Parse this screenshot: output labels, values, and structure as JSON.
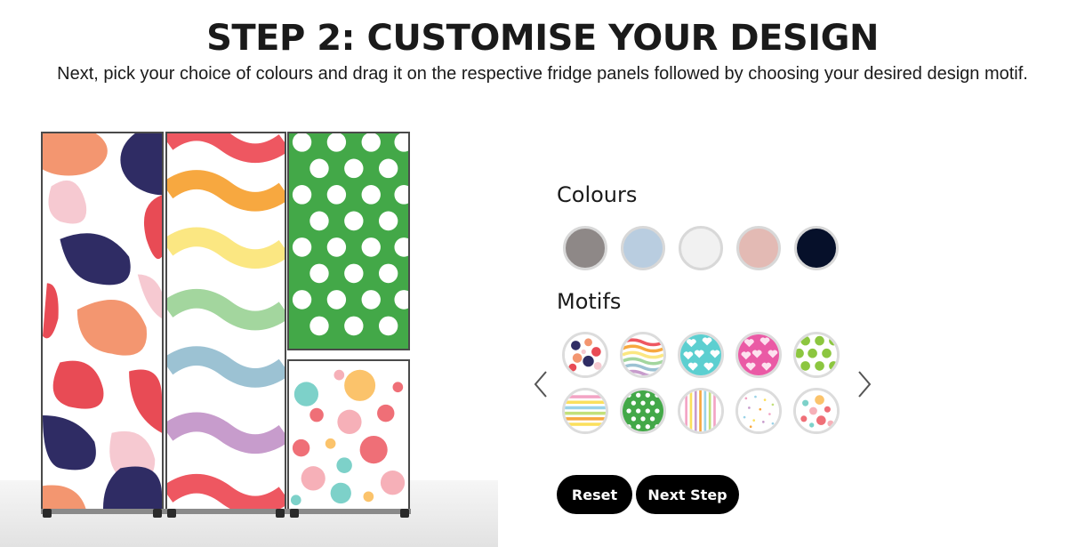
{
  "header": {
    "title": "STEP 2: CUSTOMISE YOUR DESIGN",
    "subtitle": "Next, pick your choice of colours and drag it on the respective fridge panels followed by choosing your desired design motif."
  },
  "colours": {
    "label": "Colours",
    "swatches": [
      {
        "name": "grey",
        "color": "#8e8887"
      },
      {
        "name": "light-blue",
        "color": "#b9cde0"
      },
      {
        "name": "white",
        "color": "#f1f1f1"
      },
      {
        "name": "pink",
        "color": "#e3bab4"
      },
      {
        "name": "navy",
        "color": "#06102a"
      }
    ]
  },
  "motifs": {
    "label": "Motifs",
    "items": [
      {
        "name": "paisley-motif"
      },
      {
        "name": "waves-motif"
      },
      {
        "name": "hearts-cyan-motif"
      },
      {
        "name": "hearts-pink-motif"
      },
      {
        "name": "dots-lime-motif"
      },
      {
        "name": "stripes-horizontal-motif"
      },
      {
        "name": "dots-green-motif"
      },
      {
        "name": "stripes-vertical-motif"
      },
      {
        "name": "confetti-motif"
      },
      {
        "name": "watercolor-dots-motif"
      }
    ],
    "prev_icon": "chevron-left-icon",
    "next_icon": "chevron-right-icon"
  },
  "buttons": {
    "reset": "Reset",
    "next_step": "Next Step"
  },
  "fridge": {
    "panels": [
      {
        "name": "left-panel",
        "motif": "paisley"
      },
      {
        "name": "middle-panel",
        "motif": "waves"
      },
      {
        "name": "top-right-panel",
        "motif": "dots-green"
      },
      {
        "name": "bottom-right-panel",
        "motif": "watercolor-dots"
      }
    ]
  }
}
